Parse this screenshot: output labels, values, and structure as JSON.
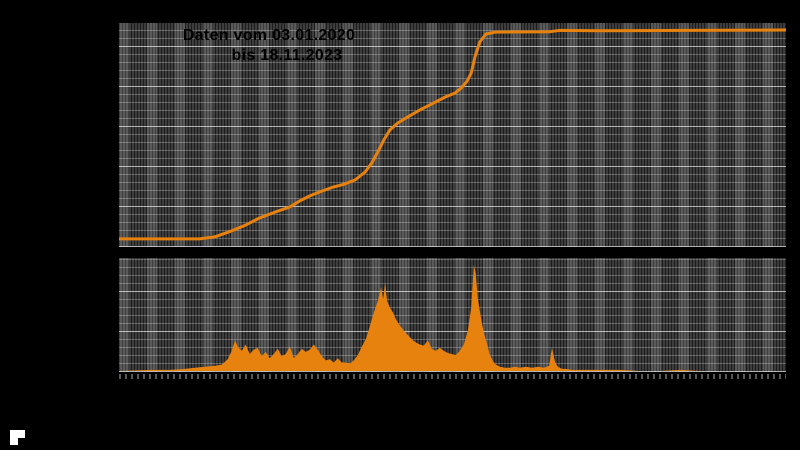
{
  "title": {
    "line1": "Daten vom 03.01.2020",
    "line2": "bis 18.11.2023"
  },
  "colors": {
    "accent": "#e8820e",
    "background": "#000000",
    "grid_base": "#3d3d3d",
    "grid_line_light": "#9a9a9a",
    "title_text": "#000000",
    "logo": "#ffffff"
  },
  "chart_data": [
    {
      "type": "line",
      "name": "cumulative-total",
      "title": "Daten vom 03.01.2020 bis 18.11.2023",
      "xlabel": "",
      "ylabel": "",
      "legend": "none",
      "grid": "on",
      "axis_labels_visible": false,
      "note": "Axis tick labels are rendered black-on-black and not readable; values normalized 0-1 of timeline (03.01.2020 - 18.11.2023) and 0-1 of final cumulative total.",
      "points": [
        [
          0.0,
          0.005
        ],
        [
          0.121,
          0.005
        ],
        [
          0.144,
          0.015
        ],
        [
          0.166,
          0.04
        ],
        [
          0.189,
          0.07
        ],
        [
          0.211,
          0.105
        ],
        [
          0.234,
          0.133
        ],
        [
          0.256,
          0.157
        ],
        [
          0.271,
          0.186
        ],
        [
          0.286,
          0.21
        ],
        [
          0.301,
          0.229
        ],
        [
          0.319,
          0.25
        ],
        [
          0.339,
          0.267
        ],
        [
          0.354,
          0.286
        ],
        [
          0.369,
          0.324
        ],
        [
          0.379,
          0.367
        ],
        [
          0.388,
          0.419
        ],
        [
          0.397,
          0.476
        ],
        [
          0.406,
          0.524
        ],
        [
          0.418,
          0.557
        ],
        [
          0.433,
          0.586
        ],
        [
          0.451,
          0.619
        ],
        [
          0.469,
          0.648
        ],
        [
          0.489,
          0.681
        ],
        [
          0.504,
          0.7
        ],
        [
          0.513,
          0.724
        ],
        [
          0.522,
          0.757
        ],
        [
          0.528,
          0.795
        ],
        [
          0.534,
          0.876
        ],
        [
          0.541,
          0.943
        ],
        [
          0.55,
          0.981
        ],
        [
          0.564,
          0.99
        ],
        [
          0.646,
          0.992
        ],
        [
          0.661,
          0.998
        ],
        [
          0.721,
          0.996
        ],
        [
          0.85,
          0.998
        ],
        [
          1.0,
          1.0
        ]
      ]
    },
    {
      "type": "area",
      "name": "daily-values-histogram",
      "xlabel": "",
      "ylabel": "",
      "legend": "none",
      "grid": "on",
      "axis_labels_visible": false,
      "note": "Daily histogram; x normalized 0-1 of timeline, height normalized 0-1 of tallest spike (at x=0.532).",
      "points": [
        [
          0.0,
          0.0
        ],
        [
          0.046,
          0.01
        ],
        [
          0.076,
          0.01
        ],
        [
          0.099,
          0.02
        ],
        [
          0.114,
          0.03
        ],
        [
          0.129,
          0.04
        ],
        [
          0.144,
          0.05
        ],
        [
          0.154,
          0.06
        ],
        [
          0.163,
          0.11
        ],
        [
          0.169,
          0.19
        ],
        [
          0.174,
          0.29
        ],
        [
          0.178,
          0.23
        ],
        [
          0.184,
          0.19
        ],
        [
          0.19,
          0.25
        ],
        [
          0.196,
          0.16
        ],
        [
          0.202,
          0.2
        ],
        [
          0.208,
          0.22
        ],
        [
          0.214,
          0.14
        ],
        [
          0.22,
          0.18
        ],
        [
          0.226,
          0.12
        ],
        [
          0.232,
          0.16
        ],
        [
          0.238,
          0.21
        ],
        [
          0.244,
          0.14
        ],
        [
          0.25,
          0.16
        ],
        [
          0.256,
          0.23
        ],
        [
          0.262,
          0.12
        ],
        [
          0.268,
          0.16
        ],
        [
          0.274,
          0.21
        ],
        [
          0.28,
          0.18
        ],
        [
          0.286,
          0.2
        ],
        [
          0.292,
          0.25
        ],
        [
          0.298,
          0.2
        ],
        [
          0.304,
          0.14
        ],
        [
          0.31,
          0.1
        ],
        [
          0.316,
          0.11
        ],
        [
          0.322,
          0.08
        ],
        [
          0.328,
          0.12
        ],
        [
          0.334,
          0.08
        ],
        [
          0.34,
          0.08
        ],
        [
          0.346,
          0.07
        ],
        [
          0.352,
          0.1
        ],
        [
          0.358,
          0.15
        ],
        [
          0.364,
          0.23
        ],
        [
          0.37,
          0.3
        ],
        [
          0.376,
          0.42
        ],
        [
          0.382,
          0.55
        ],
        [
          0.388,
          0.66
        ],
        [
          0.393,
          0.79
        ],
        [
          0.396,
          0.68
        ],
        [
          0.399,
          0.83
        ],
        [
          0.402,
          0.66
        ],
        [
          0.406,
          0.6
        ],
        [
          0.411,
          0.55
        ],
        [
          0.415,
          0.49
        ],
        [
          0.421,
          0.43
        ],
        [
          0.427,
          0.38
        ],
        [
          0.433,
          0.34
        ],
        [
          0.439,
          0.3
        ],
        [
          0.445,
          0.27
        ],
        [
          0.451,
          0.25
        ],
        [
          0.457,
          0.24
        ],
        [
          0.463,
          0.29
        ],
        [
          0.469,
          0.21
        ],
        [
          0.475,
          0.19
        ],
        [
          0.481,
          0.22
        ],
        [
          0.487,
          0.19
        ],
        [
          0.493,
          0.17
        ],
        [
          0.499,
          0.16
        ],
        [
          0.505,
          0.15
        ],
        [
          0.511,
          0.19
        ],
        [
          0.517,
          0.25
        ],
        [
          0.523,
          0.38
        ],
        [
          0.528,
          0.6
        ],
        [
          0.532,
          1.0
        ],
        [
          0.535,
          0.92
        ],
        [
          0.538,
          0.68
        ],
        [
          0.543,
          0.49
        ],
        [
          0.547,
          0.36
        ],
        [
          0.552,
          0.25
        ],
        [
          0.556,
          0.15
        ],
        [
          0.561,
          0.09
        ],
        [
          0.565,
          0.06
        ],
        [
          0.571,
          0.04
        ],
        [
          0.579,
          0.03
        ],
        [
          0.586,
          0.03
        ],
        [
          0.594,
          0.04
        ],
        [
          0.601,
          0.03
        ],
        [
          0.61,
          0.04
        ],
        [
          0.619,
          0.03
        ],
        [
          0.628,
          0.04
        ],
        [
          0.637,
          0.03
        ],
        [
          0.645,
          0.05
        ],
        [
          0.649,
          0.22
        ],
        [
          0.654,
          0.08
        ],
        [
          0.658,
          0.04
        ],
        [
          0.664,
          0.02
        ],
        [
          0.67,
          0.02
        ],
        [
          0.679,
          0.01
        ],
        [
          0.691,
          0.01
        ],
        [
          0.706,
          0.01
        ],
        [
          0.721,
          0.01
        ],
        [
          0.751,
          0.01
        ],
        [
          0.781,
          0.0
        ],
        [
          0.811,
          0.0
        ],
        [
          0.841,
          0.01
        ],
        [
          0.871,
          0.0
        ],
        [
          0.901,
          0.0
        ],
        [
          0.931,
          0.0
        ],
        [
          0.961,
          0.0
        ],
        [
          1.0,
          0.0
        ]
      ]
    }
  ],
  "logo": {
    "name": "white-corner-mark"
  }
}
